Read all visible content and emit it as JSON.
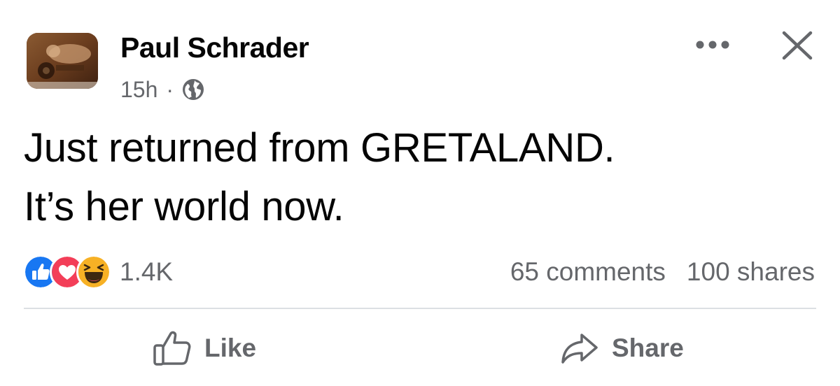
{
  "post": {
    "author": "Paul Schrader",
    "time": "15h",
    "separator": "·",
    "audience_icon": "globe-icon",
    "text_line1": "Just returned from GRETALAND.",
    "text_line2": "It’s her world now."
  },
  "header_actions": {
    "more_icon": "more-options-icon",
    "close_icon": "close-icon"
  },
  "engagement": {
    "reaction_icons": [
      "like-reaction-icon",
      "love-reaction-icon",
      "haha-reaction-icon"
    ],
    "reaction_count": "1.4K",
    "comments": "65 comments",
    "shares": "100 shares"
  },
  "actions": {
    "like_label": "Like",
    "like_icon": "thumbs-up-icon",
    "share_label": "Share",
    "share_icon": "share-arrow-icon"
  },
  "colors": {
    "primary_text": "#050505",
    "secondary_text": "#65676b",
    "like_blue": "#1877f2",
    "love_red": "#f33e58",
    "haha_yellow": "#f7b125",
    "divider": "#dcdfe3"
  }
}
